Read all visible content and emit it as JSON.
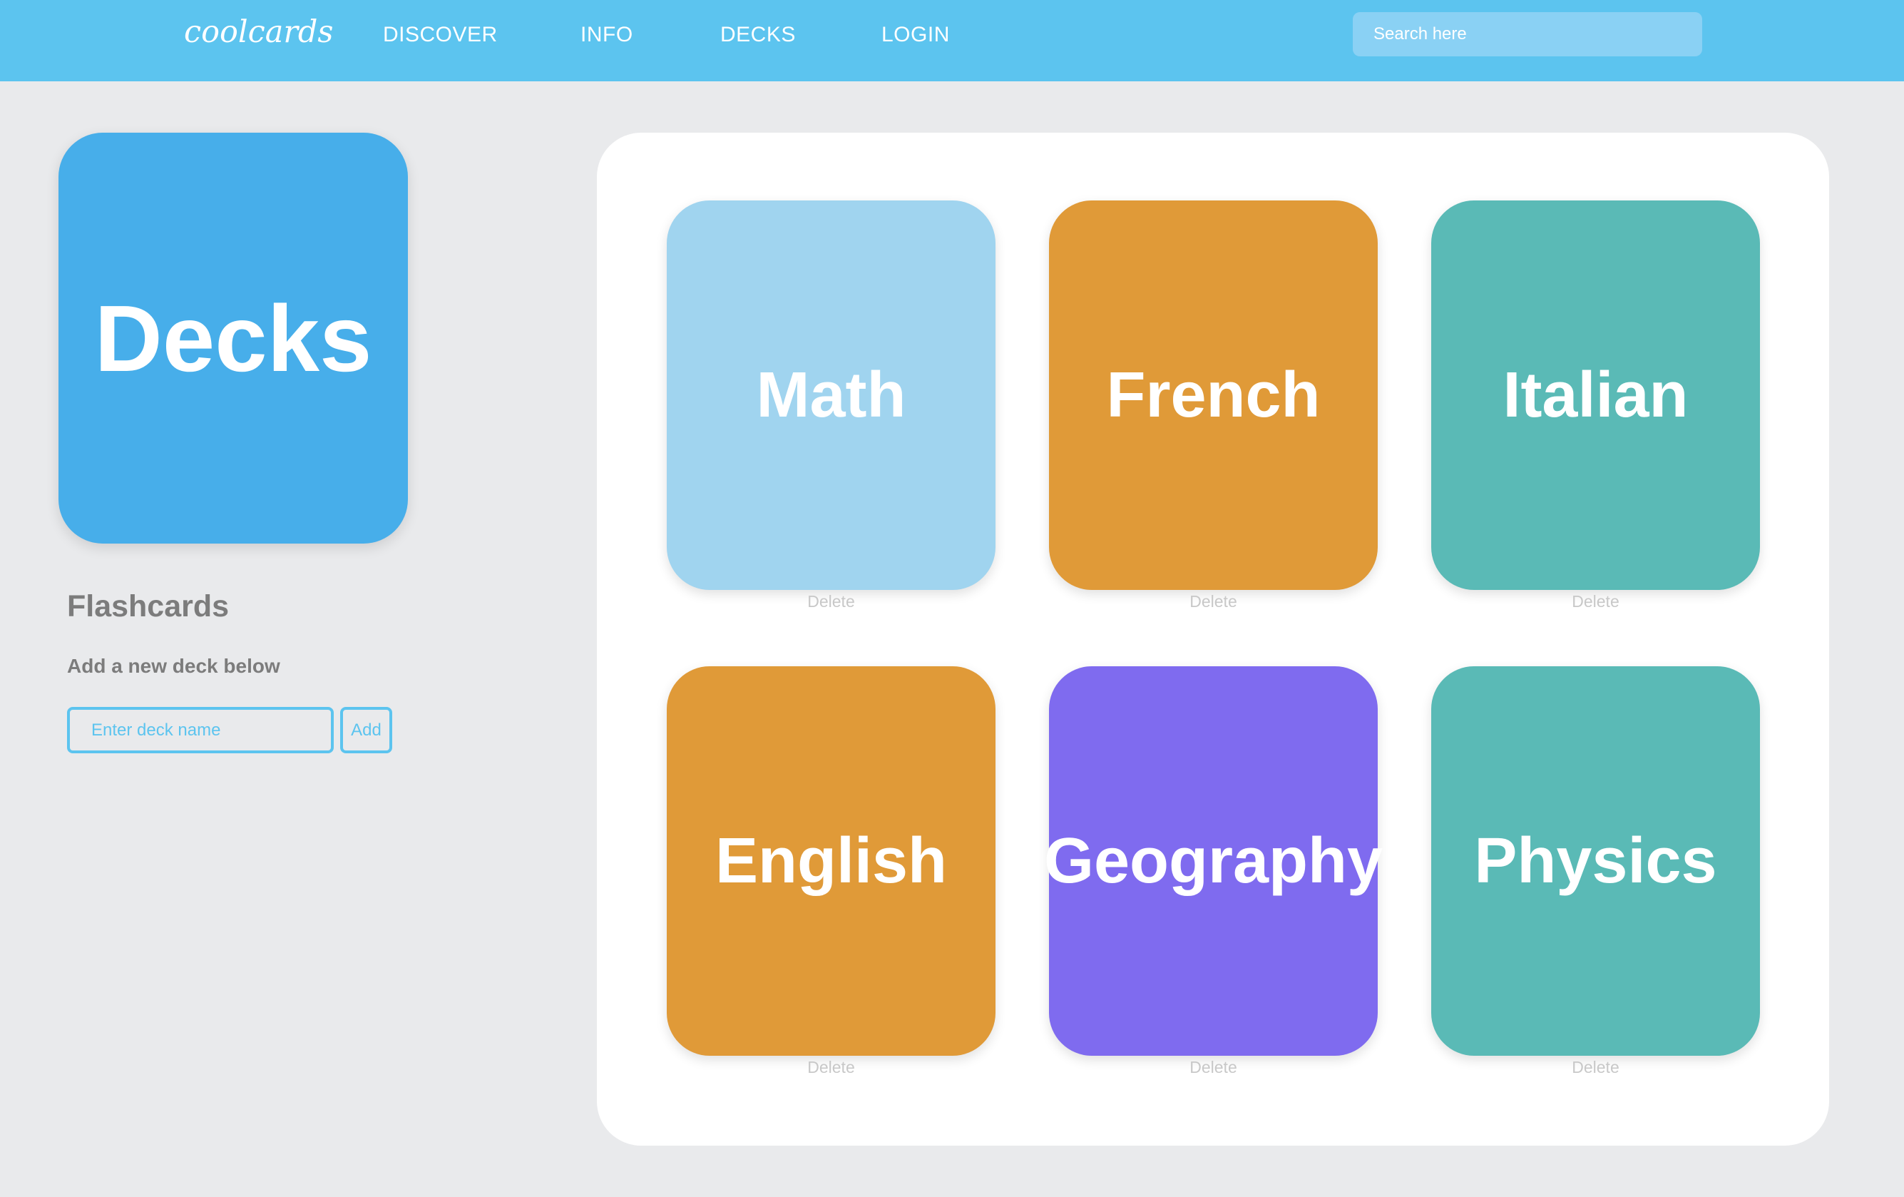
{
  "nav": {
    "brand": "coolcards",
    "links": [
      "DISCOVER",
      "INFO",
      "DECKS",
      "LOGIN"
    ],
    "search_placeholder": "Search here"
  },
  "sidebar": {
    "hero_title": "Decks",
    "heading": "Flashcards",
    "subheading": "Add a new deck below",
    "input_placeholder": "Enter deck name",
    "add_label": "Add"
  },
  "decks": [
    {
      "name": "Math",
      "color": "#a0d4ef",
      "delete_label": "Delete"
    },
    {
      "name": "French",
      "color": "#e09a38",
      "delete_label": "Delete"
    },
    {
      "name": "Italian",
      "color": "#5abab6",
      "delete_label": "Delete"
    },
    {
      "name": "English",
      "color": "#e09a38",
      "delete_label": "Delete"
    },
    {
      "name": "Geography",
      "color": "#7f6bef",
      "delete_label": "Delete"
    },
    {
      "name": "Physics",
      "color": "#5abab6",
      "delete_label": "Delete"
    }
  ],
  "colors": {
    "nav_bar": "#5cc4ef",
    "hero_card": "#47aeea",
    "page_bg": "#e9eaec"
  }
}
